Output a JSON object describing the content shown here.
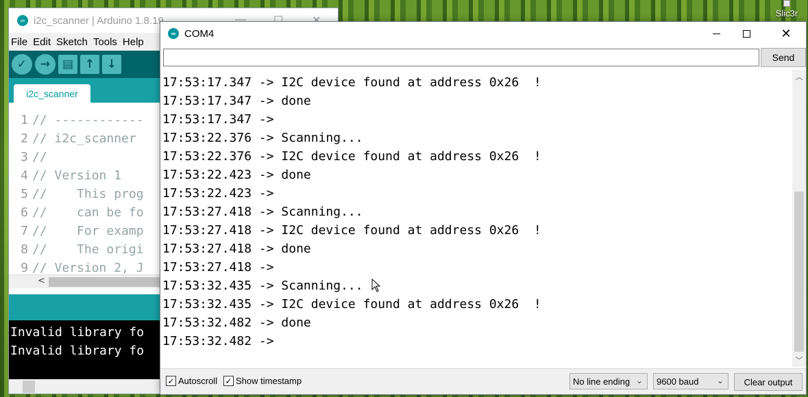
{
  "desktop": {
    "icon_label": "Slic3r"
  },
  "ide": {
    "title": "i2c_scanner | Arduino 1.8.19",
    "menu": [
      "File",
      "Edit",
      "Sketch",
      "Tools",
      "Help"
    ],
    "tab": "i2c_scanner",
    "code_lines": [
      {
        "n": "1",
        "text": "// ------------"
      },
      {
        "n": "2",
        "text": "// i2c_scanner"
      },
      {
        "n": "3",
        "text": "//"
      },
      {
        "n": "4",
        "text": "// Version 1"
      },
      {
        "n": "5",
        "text": "//    This prog"
      },
      {
        "n": "6",
        "text": "//    can be fo"
      },
      {
        "n": "7",
        "text": "//    For examp"
      },
      {
        "n": "8",
        "text": "//    The origi"
      },
      {
        "n": "9",
        "text": "// Version 2, J"
      }
    ],
    "console_lines": [
      "Invalid library fo",
      "Invalid library fo"
    ]
  },
  "serial": {
    "title": "COM4",
    "input_value": "",
    "send_label": "Send",
    "output_lines": [
      "17:53:17.347 -> I2C device found at address 0x26  !",
      "17:53:17.347 -> done",
      "17:53:17.347 -> ",
      "17:53:22.376 -> Scanning...",
      "17:53:22.376 -> I2C device found at address 0x26  !",
      "17:53:22.423 -> done",
      "17:53:22.423 -> ",
      "17:53:27.418 -> Scanning...",
      "17:53:27.418 -> I2C device found at address 0x26  !",
      "17:53:27.418 -> done",
      "17:53:27.418 -> ",
      "17:53:32.435 -> Scanning...",
      "17:53:32.435 -> I2C device found at address 0x26  !",
      "17:53:32.482 -> done",
      "17:53:32.482 -> "
    ],
    "autoscroll": {
      "label": "Autoscroll",
      "checked": true
    },
    "show_timestamp": {
      "label": "Show timestamp",
      "checked": true
    },
    "line_ending": "No line ending",
    "baud": "9600 baud",
    "clear_label": "Clear output"
  },
  "colors": {
    "arduino_teal": "#00979c",
    "toolbar_dark": "#006468"
  }
}
